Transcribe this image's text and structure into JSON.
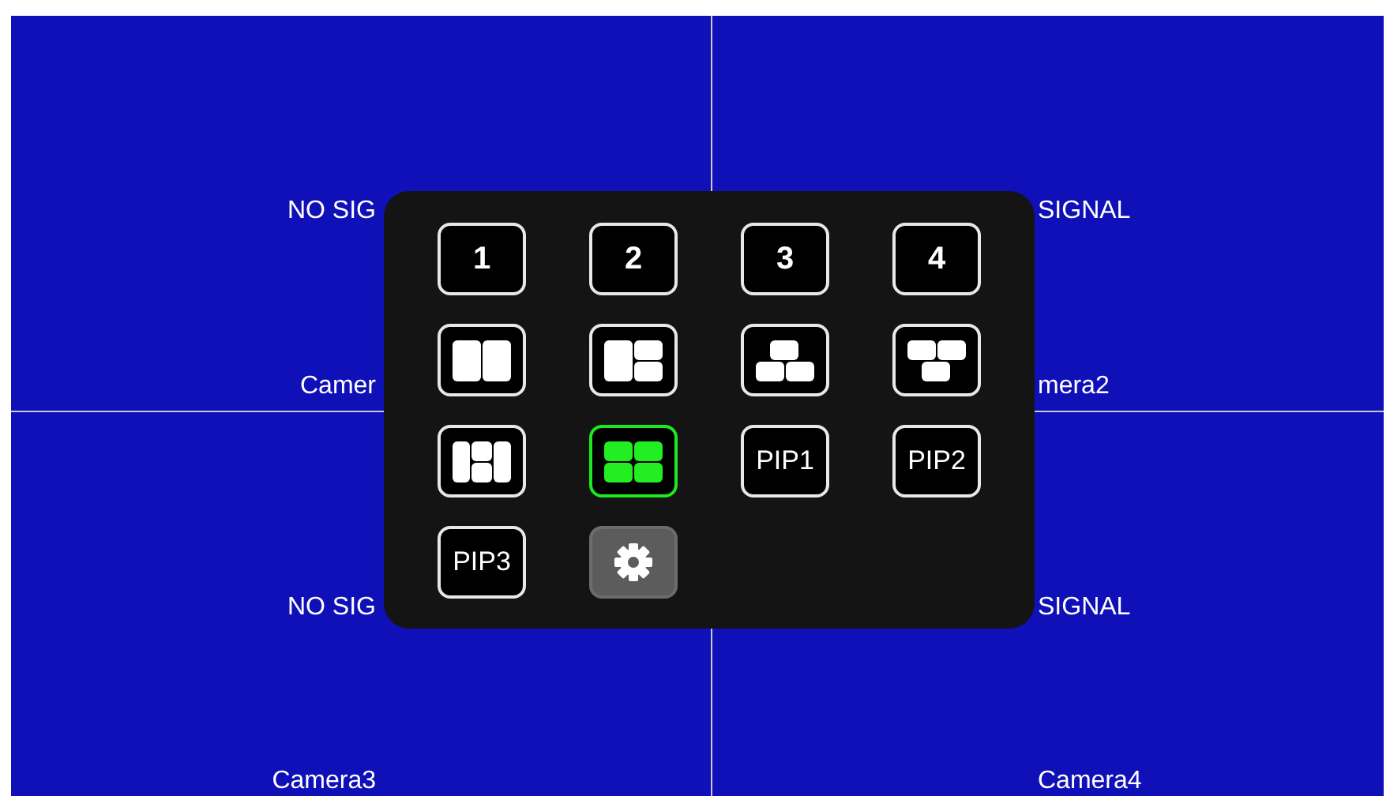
{
  "cameras": [
    {
      "status": "NO SIG",
      "name": "Camer"
    },
    {
      "status": "SIGNAL",
      "name": "mera2"
    },
    {
      "status": "NO SIG",
      "name": "Camera3"
    },
    {
      "status": "SIGNAL",
      "name": "Camera4"
    }
  ],
  "menu": {
    "buttons": [
      {
        "kind": "number",
        "label": "1",
        "selected": false
      },
      {
        "kind": "number",
        "label": "2",
        "selected": false
      },
      {
        "kind": "number",
        "label": "3",
        "selected": false
      },
      {
        "kind": "number",
        "label": "4",
        "selected": false
      },
      {
        "kind": "split2",
        "selected": false
      },
      {
        "kind": "split3",
        "selected": false
      },
      {
        "kind": "triup",
        "selected": false
      },
      {
        "kind": "tridown",
        "selected": false
      },
      {
        "kind": "splith",
        "selected": false
      },
      {
        "kind": "quad",
        "selected": true
      },
      {
        "kind": "pip",
        "label": "PIP1",
        "selected": false
      },
      {
        "kind": "pip",
        "label": "PIP2",
        "selected": false
      },
      {
        "kind": "pip",
        "label": "PIP3",
        "selected": false
      },
      {
        "kind": "settings",
        "selected": false
      }
    ]
  }
}
